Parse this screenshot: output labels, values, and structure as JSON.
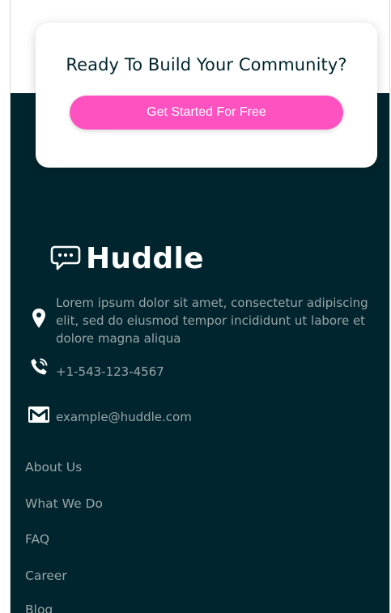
{
  "cta": {
    "title": "Ready To Build Your Community?",
    "button_label": "Get Started For Free"
  },
  "brand": {
    "name": "Huddle",
    "logo_icon": "chat-bubble-icon"
  },
  "contact": {
    "address": "Lorem ipsum dolor sit amet, consectetur adipiscing elit, sed do eiusmod tempor incididunt ut labore et dolore magna aliqua",
    "address_icon": "location-pin-icon",
    "phone": "+1-543-123-4567",
    "phone_icon": "phone-icon",
    "email": "example@huddle.com",
    "email_icon": "mail-icon"
  },
  "nav": {
    "links": [
      "About Us",
      "What We Do",
      "FAQ",
      "Career",
      "Blog"
    ]
  },
  "colors": {
    "footer_bg": "#00252e",
    "accent": "#ff52c1",
    "muted_text": "#9aa5a8",
    "heading": "#00252e"
  }
}
